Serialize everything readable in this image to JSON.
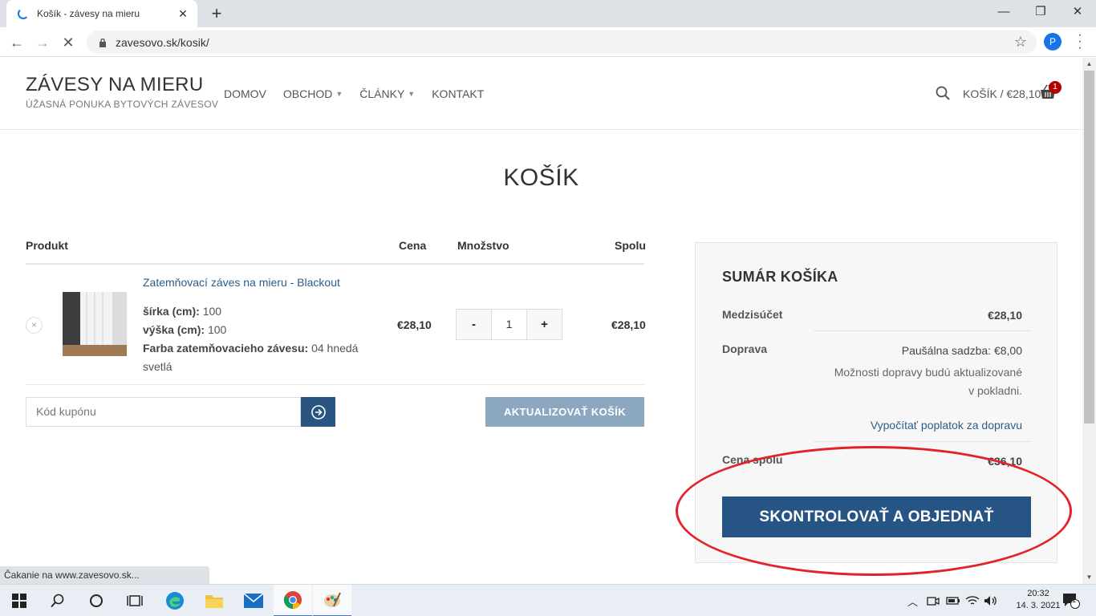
{
  "browser": {
    "tab_title": "Košík - závesy na mieru",
    "url": "zavesovo.sk/kosik/",
    "profile_initial": "P",
    "status_text": "Čakanie na www.zavesovo.sk..."
  },
  "site": {
    "logo_title": "ZÁVESY NA MIERU",
    "logo_subtitle": "ÚŽASNÁ PONUKA BYTOVÝCH ZÁVESOV",
    "nav": [
      "DOMOV",
      "OBCHOD",
      "ČLÁNKY",
      "KONTAKT"
    ],
    "cart_link": "KOŠÍK / €28,10",
    "cart_count": "1"
  },
  "page": {
    "title": "KOŠÍK"
  },
  "cart_table": {
    "headers": {
      "product": "Produkt",
      "price": "Cena",
      "quantity": "Množstvo",
      "total": "Spolu"
    },
    "item": {
      "name": "Zatemňovací záves na mieru - Blackout",
      "attrs": [
        {
          "label": "šírka (cm):",
          "value": "100"
        },
        {
          "label": "výška (cm):",
          "value": "100"
        },
        {
          "label": "Farba zatemňovacieho závesu:",
          "value": "04 hnedá"
        }
      ],
      "attr_wrap": "svetlá",
      "price": "€28,10",
      "quantity": "1",
      "subtotal": "€28,10",
      "remove_symbol": "×"
    },
    "qty_minus": "-",
    "qty_plus": "+",
    "coupon_placeholder": "Kód kupónu",
    "update_button": "AKTUALIZOVAŤ KOŠÍK"
  },
  "summary": {
    "title": "SUMÁR KOŠÍKA",
    "subtotal_label": "Medzisúčet",
    "subtotal_value": "€28,10",
    "shipping_label": "Doprava",
    "shipping_rate": "Paušálna sadzba: €8,00",
    "shipping_note_1": "Možnosti dopravy budú aktualizované",
    "shipping_note_2": "v pokladni.",
    "shipping_calc": "Vypočítať poplatok za dopravu",
    "total_label": "Cena spolu",
    "total_value": "€36,10",
    "checkout_button": "SKONTROLOVAŤ A OBJEDNAŤ"
  },
  "annotation": {
    "color": "#e2232a"
  },
  "taskbar": {
    "time": "20:32",
    "date": "14. 3. 2021",
    "notification_count": "1"
  }
}
